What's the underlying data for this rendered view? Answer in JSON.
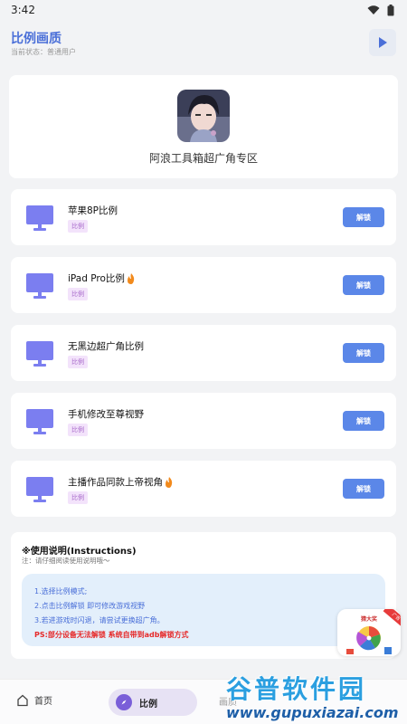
{
  "status_bar": {
    "time": "3:42"
  },
  "header": {
    "title": "比例画质",
    "status": "当前状态：普通用户"
  },
  "profile": {
    "name": "阿浪工具箱超广角专区"
  },
  "options": [
    {
      "title": "苹果8P比例",
      "tag": "比例",
      "button": "解锁",
      "hot": false
    },
    {
      "title": "iPad Pro比例",
      "tag": "比例",
      "button": "解锁",
      "hot": true
    },
    {
      "title": "无黑边超广角比例",
      "tag": "比例",
      "button": "解锁",
      "hot": false
    },
    {
      "title": "手机修改至尊视野",
      "tag": "比例",
      "button": "解锁",
      "hot": false
    },
    {
      "title": "主播作品同款上帝视角",
      "tag": "比例",
      "button": "解锁",
      "hot": true
    }
  ],
  "instructions": {
    "title": "※使用说明(Instructions)",
    "note": "注：请仔细阅读使用说明哦～",
    "lines": [
      "1.选择比例模式;",
      "2.点击比例解锁 即可修改游戏视野",
      "3.若进游戏时闪退，请尝试更换超广角。"
    ],
    "warning": "PS:部分设备无法解锁 系统自带到adb解锁方式"
  },
  "ad": {
    "text": "猜大奖",
    "corner": "广告"
  },
  "bottom_nav": {
    "home": "首页",
    "ratio": "比例",
    "third": "画质"
  },
  "watermark": {
    "title": "谷普软件园",
    "url": "www.gupuxiazai.com"
  },
  "colors": {
    "accent": "#4a6fd8",
    "button": "#5b87e8",
    "monitor": "#7b7ef0",
    "tag_bg": "#f3e3fb",
    "warning": "#e62a2a"
  }
}
